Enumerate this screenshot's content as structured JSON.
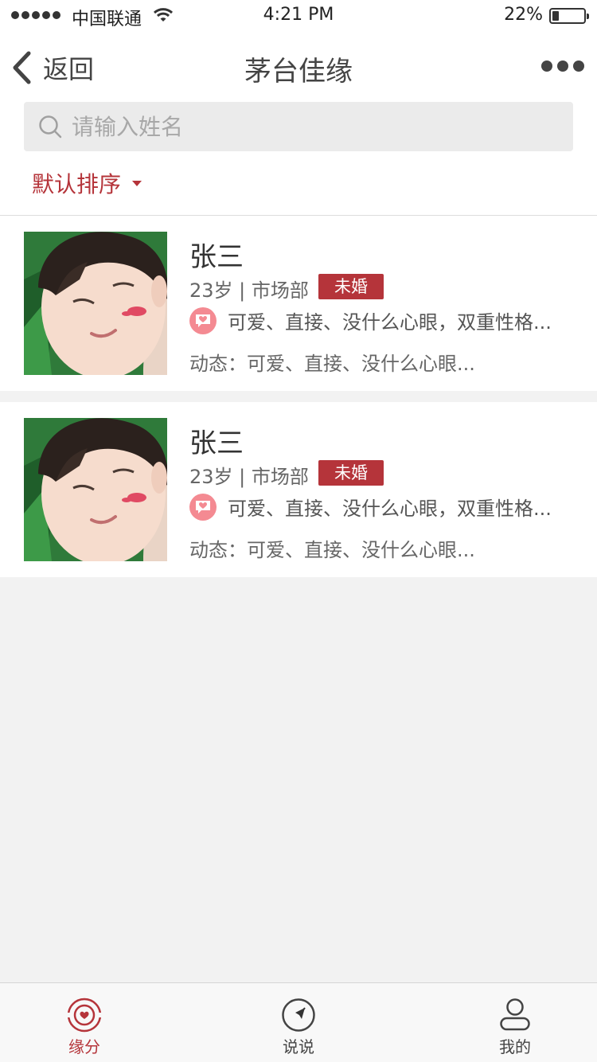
{
  "status_bar": {
    "carrier": "中国联通",
    "time": "4:21 PM",
    "battery_percent_text": "22%",
    "battery_level": 0.22
  },
  "nav": {
    "back_label": "返回",
    "title": "茅台佳缘"
  },
  "search": {
    "placeholder": "请输入姓名"
  },
  "sort": {
    "label": "默认排序"
  },
  "cards": [
    {
      "name": "张三",
      "meta": "23岁 | 市场部",
      "status_badge": "未婚",
      "tags": "可爱、直接、没什么心眼，双重性格...",
      "moment": "动态：可爱、直接、没什么心眼..."
    },
    {
      "name": "张三",
      "meta": "23岁 | 市场部",
      "status_badge": "未婚",
      "tags": "可爱、直接、没什么心眼，双重性格...",
      "moment": "动态：可爱、直接、没什么心眼..."
    }
  ],
  "tabbar": {
    "items": [
      {
        "label": "缘分",
        "icon": "heart-radar-icon",
        "active": true
      },
      {
        "label": "说说",
        "icon": "compass-icon",
        "active": false
      },
      {
        "label": "我的",
        "icon": "user-icon",
        "active": false
      }
    ]
  },
  "colors": {
    "accent": "#b5343a",
    "tag_icon": "#f48a92",
    "background": "#f2f2f2"
  }
}
